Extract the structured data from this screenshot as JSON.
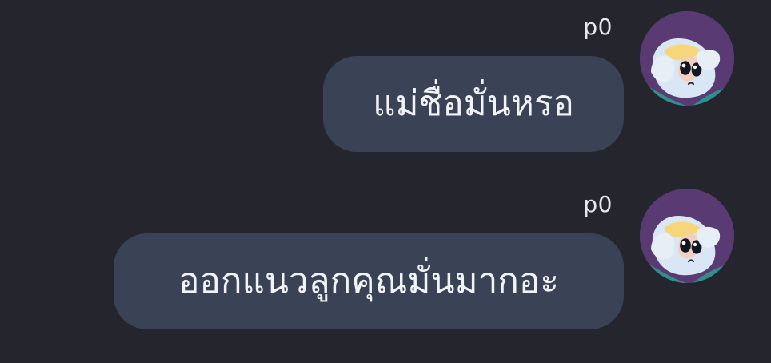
{
  "conversation": {
    "messages": [
      {
        "sender": "p0",
        "text": "แม่ชื่อมั่นหรอ",
        "avatar_icon": "powerpuff-girl-avatar-icon"
      },
      {
        "sender": "p0",
        "text": "ออกแนวลูกคุณมั่นมากอะ",
        "avatar_icon": "powerpuff-girl-avatar-icon"
      }
    ]
  },
  "colors": {
    "background": "#25262d",
    "bubble": "#3a4356",
    "text": "#f1f3f7",
    "sender_text": "#e8e8ea",
    "avatar_purple": "#5a3a73",
    "avatar_teal": "#2f8f8a"
  }
}
